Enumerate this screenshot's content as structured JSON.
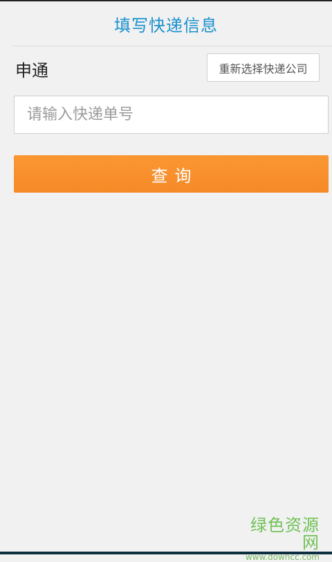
{
  "header": {
    "title": "填写快递信息"
  },
  "company": {
    "name": "申通",
    "reselect_label": "重新选择快递公司"
  },
  "tracking": {
    "value": "",
    "placeholder": "请输入快递单号"
  },
  "actions": {
    "query_label": "查询"
  },
  "watermark": {
    "main": "绿色资源网",
    "sub": "www.downcc.com"
  },
  "colors": {
    "accent": "#1a91cf",
    "button": "#f58a27",
    "watermark": "#67c04c"
  }
}
